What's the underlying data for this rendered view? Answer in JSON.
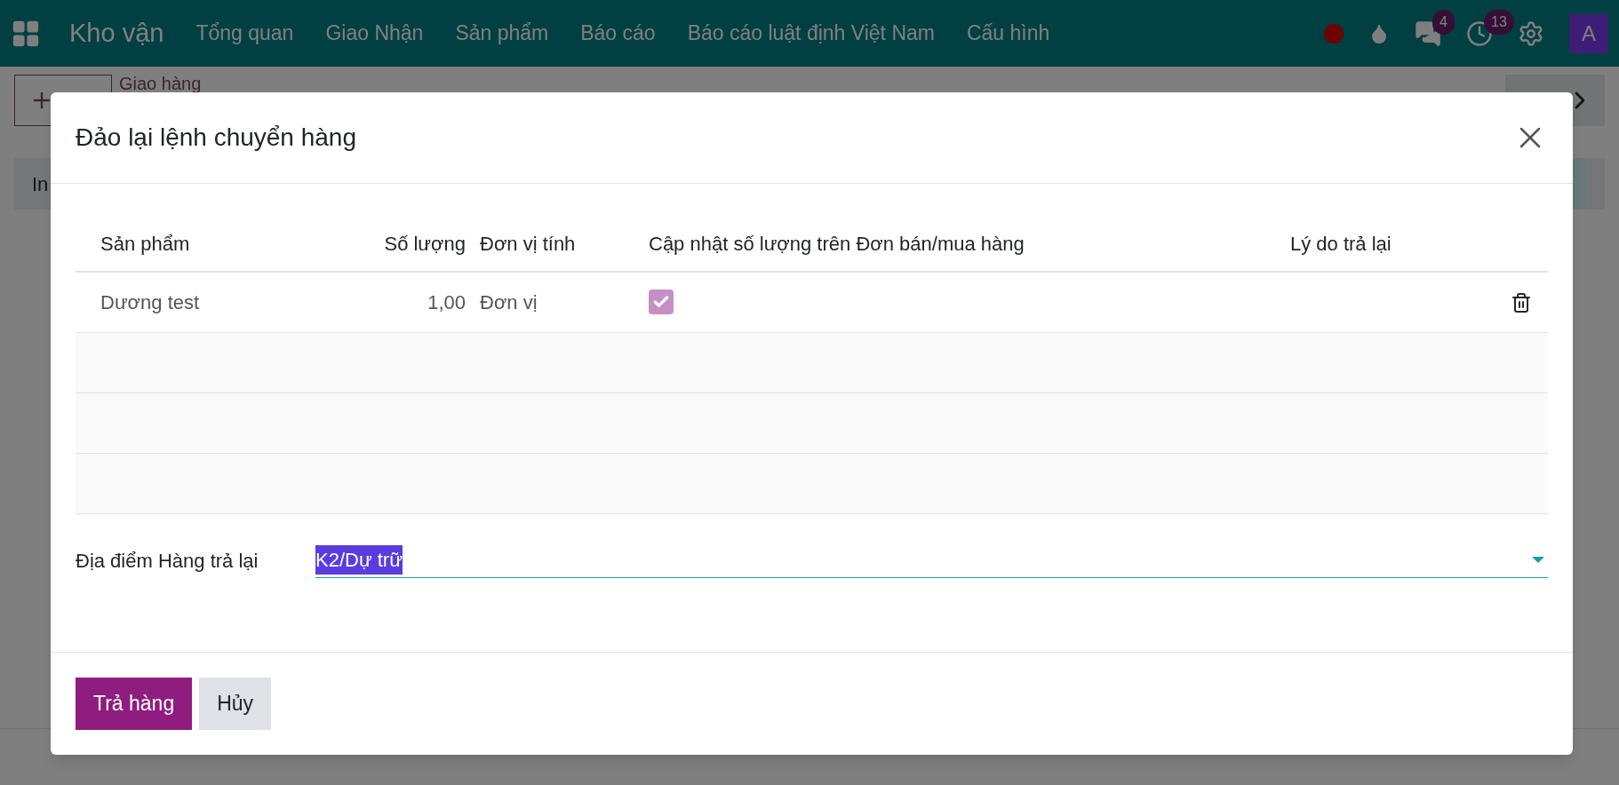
{
  "navbar": {
    "app": "Kho vận",
    "menu": [
      "Tổng quan",
      "Giao Nhận",
      "Sản phẩm",
      "Báo cáo",
      "Báo cáo luật định Việt Nam",
      "Cấu hình"
    ],
    "chat_count": "4",
    "activity_count": "13",
    "avatar": "A"
  },
  "background": {
    "breadcrumb": "Giao hàng",
    "tab": "In"
  },
  "dialog": {
    "title": "Đảo lại lệnh chuyển hàng",
    "columns": [
      "Sản phẩm",
      "Số lượng",
      "Đơn vị tính",
      "Cập nhật số lượng trên Đơn bán/mua hàng",
      "Lý do trả lại"
    ],
    "rows": [
      {
        "product": "Dương test",
        "quantity": "1,00",
        "uom": "Đơn vị",
        "update_quantity": true
      }
    ],
    "location": {
      "label": "Địa điểm Hàng trả lại",
      "value": "K2/Dự trữ",
      "highlighted": true
    },
    "buttons": [
      {
        "label": "Trả hàng",
        "kind": "primary"
      },
      {
        "label": "Hủy",
        "kind": "secondary"
      }
    ]
  }
}
